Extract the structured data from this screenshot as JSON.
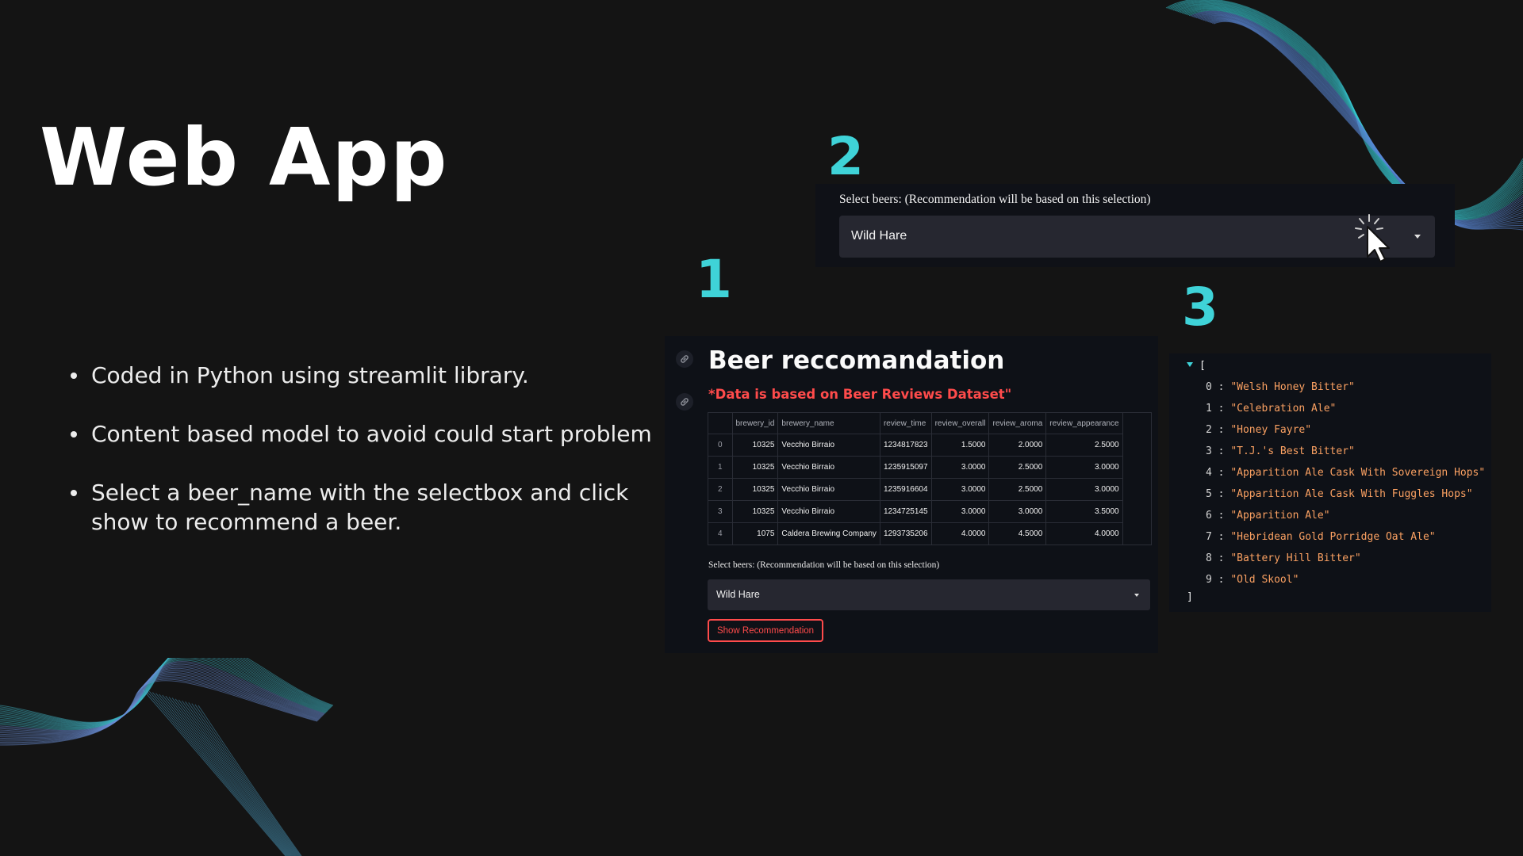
{
  "slide": {
    "title": "Web App",
    "bullets": [
      "Coded in Python using streamlit library.",
      "Content based model to avoid  could start problem",
      "Select a beer_name with the selectbox and click show to recommend a beer."
    ],
    "step_numbers": [
      "1",
      "2",
      "3"
    ],
    "accent_color": "#3fd3d8"
  },
  "panel2": {
    "select_label": "Select beers: (Recommendation will be based on this selection)",
    "selected_value": "Wild Hare"
  },
  "panel1": {
    "app_title": "Beer reccomandation",
    "data_note": "*Data is based on Beer Reviews Dataset\"",
    "table": {
      "columns": [
        "",
        "brewery_id",
        "brewery_name",
        "review_time",
        "review_overall",
        "review_aroma",
        "review_appearance"
      ],
      "rows": [
        [
          "0",
          "10325",
          "Vecchio Birraio",
          "1234817823",
          "1.5000",
          "2.0000",
          "2.5000"
        ],
        [
          "1",
          "10325",
          "Vecchio Birraio",
          "1235915097",
          "3.0000",
          "2.5000",
          "3.0000"
        ],
        [
          "2",
          "10325",
          "Vecchio Birraio",
          "1235916604",
          "3.0000",
          "2.5000",
          "3.0000"
        ],
        [
          "3",
          "10325",
          "Vecchio Birraio",
          "1234725145",
          "3.0000",
          "3.0000",
          "3.5000"
        ],
        [
          "4",
          "1075",
          "Caldera Brewing Company",
          "1293735206",
          "4.0000",
          "4.5000",
          "4.0000"
        ]
      ]
    },
    "select_label": "Select beers: (Recommendation will be based on this selection)",
    "selected_value": "Wild Hare",
    "button_label": "Show Recommendation",
    "accent_color": "#ff4b4b"
  },
  "panel3": {
    "open_bracket": "[",
    "close_bracket": "]",
    "items": [
      {
        "index": "0",
        "value": "\"Welsh Honey Bitter\""
      },
      {
        "index": "1",
        "value": "\"Celebration Ale\""
      },
      {
        "index": "2",
        "value": "\"Honey Fayre\""
      },
      {
        "index": "3",
        "value": "\"T.J.'s Best Bitter\""
      },
      {
        "index": "4",
        "value": "\"Apparition Ale Cask With Sovereign Hops\""
      },
      {
        "index": "5",
        "value": "\"Apparition Ale Cask With Fuggles Hops\""
      },
      {
        "index": "6",
        "value": "\"Apparition Ale\""
      },
      {
        "index": "7",
        "value": "\"Hebridean Gold Porridge Oat Ale\""
      },
      {
        "index": "8",
        "value": "\"Battery Hill Bitter\""
      },
      {
        "index": "9",
        "value": "\"Old Skool\""
      }
    ],
    "value_color": "#fba162"
  },
  "icons": {
    "link": "link-icon",
    "cursor": "mouse-pointer-icon",
    "caret": "chevron-down-icon"
  }
}
